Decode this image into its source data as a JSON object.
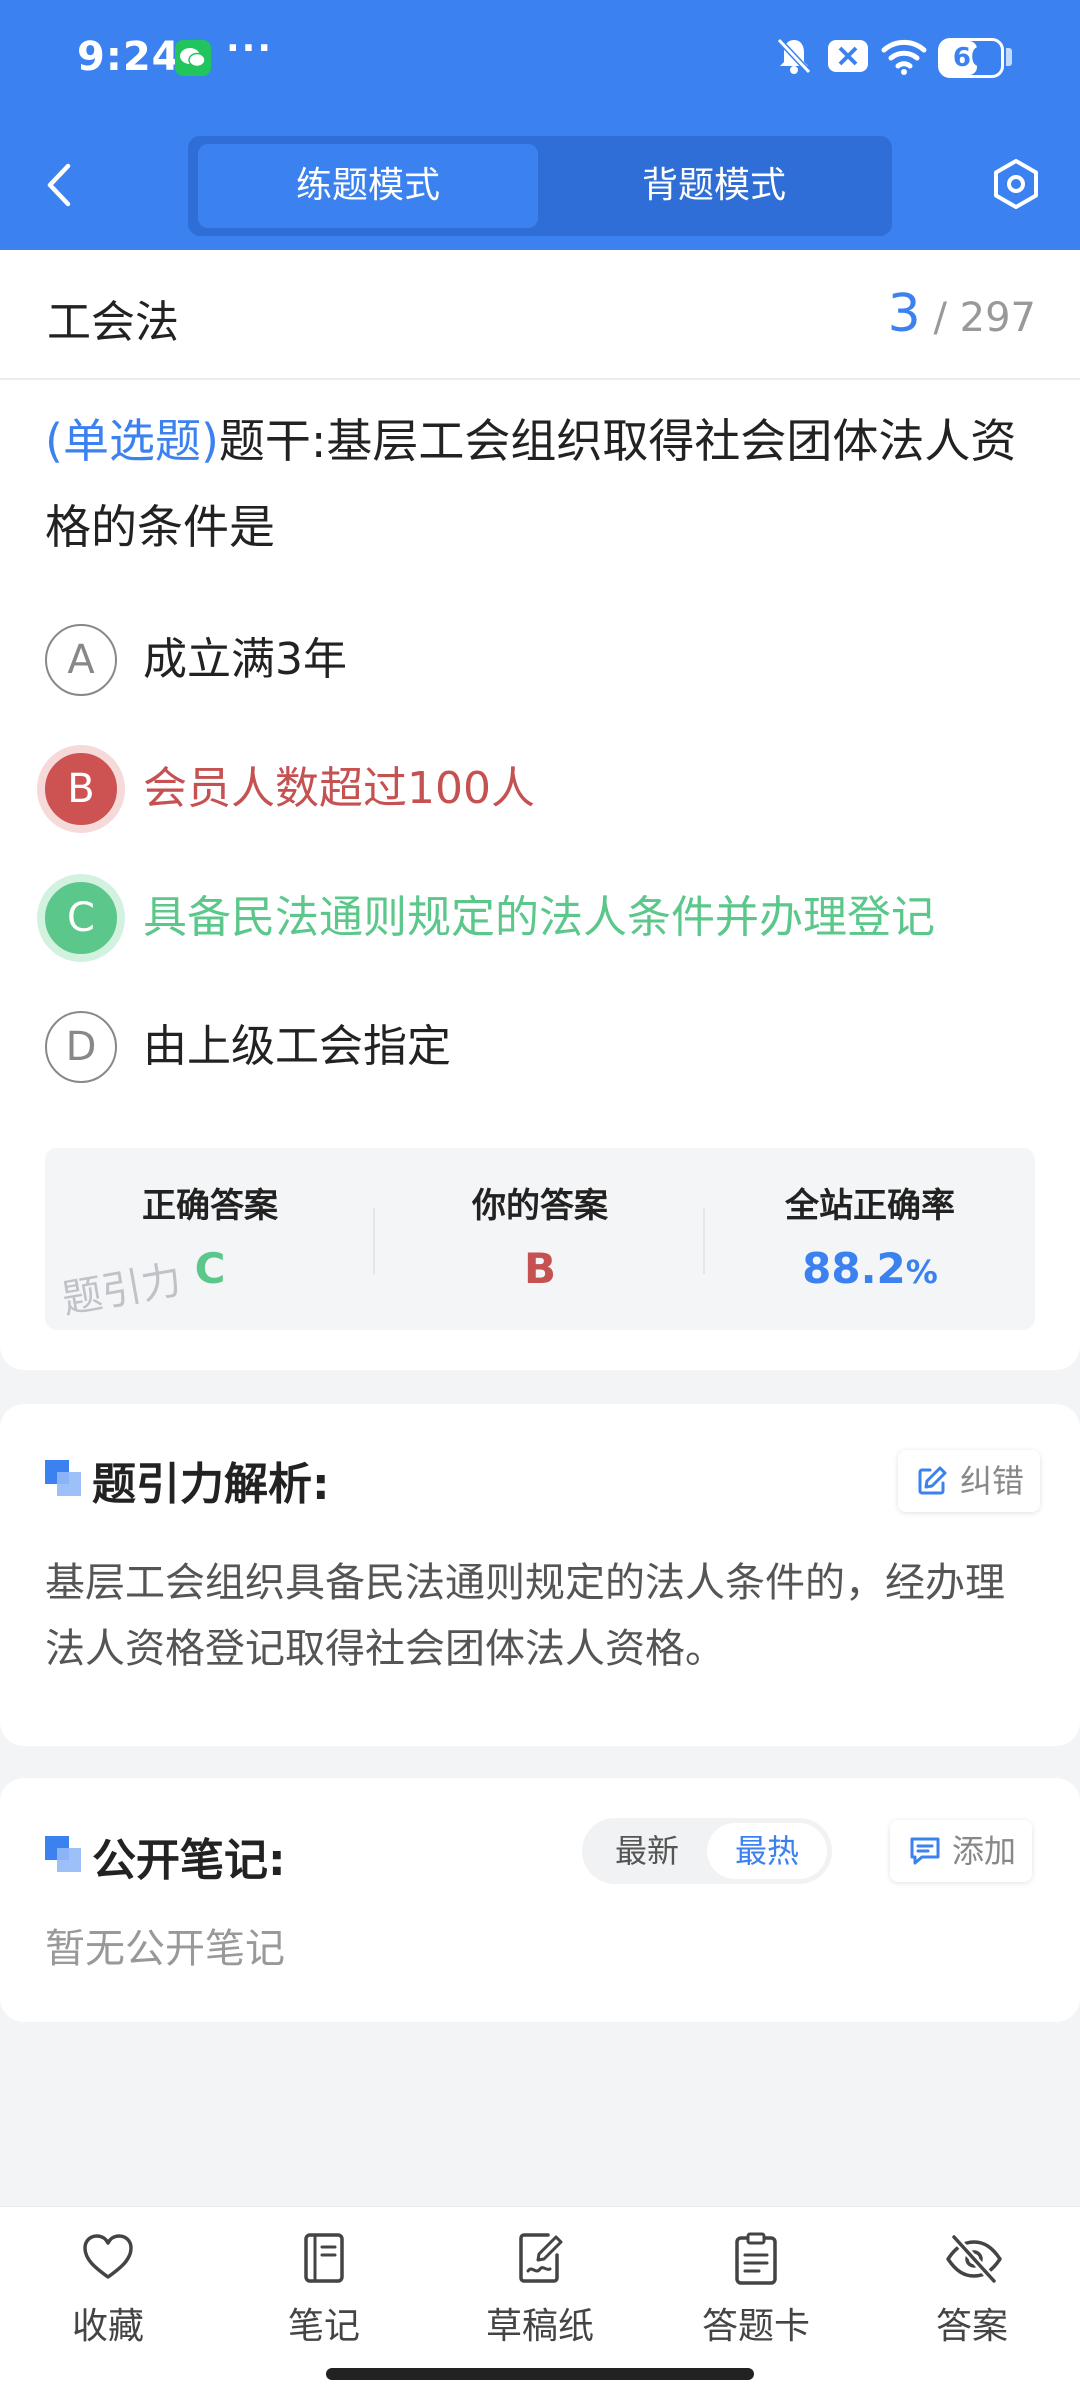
{
  "status_bar": {
    "time": "9:24",
    "dots": "···",
    "battery": "60",
    "battery_level": 0.6
  },
  "header": {
    "tabs": [
      {
        "label": "练题模式",
        "active": true
      },
      {
        "label": "背题模式",
        "active": false
      }
    ]
  },
  "title_row": {
    "chapter": "工会法",
    "current": "3",
    "separator": "/",
    "total": "297"
  },
  "question": {
    "type": "(单选题)",
    "stem": "题干:基层工会组织取得社会团体法人资格的条件是",
    "options": [
      {
        "letter": "A",
        "text": "成立满3年",
        "state": "normal"
      },
      {
        "letter": "B",
        "text": "会员人数超过100人",
        "state": "wrong"
      },
      {
        "letter": "C",
        "text": "具备民法通则规定的法人条件并办理登记",
        "state": "right"
      },
      {
        "letter": "D",
        "text": "由上级工会指定",
        "state": "normal"
      }
    ]
  },
  "answer_box": {
    "correct_label": "正确答案",
    "correct_value": "C",
    "yours_label": "你的答案",
    "yours_value": "B",
    "rate_label": "全站正确率",
    "rate_value": "88.2",
    "rate_unit": "%",
    "watermark": "题引力"
  },
  "analysis": {
    "title": "题引力解析:",
    "report_button": "纠错",
    "text": "基层工会组织具备民法通则规定的法人条件的，经办理法人资格登记取得社会团体法人资格。"
  },
  "notes": {
    "title": "公开笔记:",
    "sort_options": [
      "最新",
      "最热"
    ],
    "active_sort": "最热",
    "add_button": "添加",
    "empty_text": "暂无公开笔记"
  },
  "bottom_nav": [
    {
      "label": "收藏",
      "icon": "heart-icon"
    },
    {
      "label": "笔记",
      "icon": "notebook-icon"
    },
    {
      "label": "草稿纸",
      "icon": "draft-paper-icon"
    },
    {
      "label": "答题卡",
      "icon": "answer-card-icon"
    },
    {
      "label": "答案",
      "icon": "eye-off-icon"
    }
  ],
  "colors": {
    "primary": "#3b82f0",
    "wrong": "#cd5252",
    "right": "#5cc78a"
  }
}
